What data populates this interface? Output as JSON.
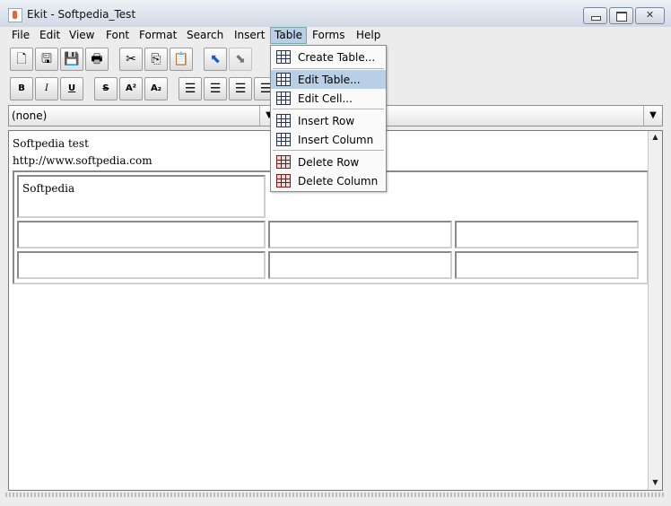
{
  "window": {
    "title": "Ekit - Softpedia_Test"
  },
  "menubar": [
    "File",
    "Edit",
    "View",
    "Font",
    "Format",
    "Search",
    "Insert",
    "Table",
    "Forms",
    "Help"
  ],
  "table_menu": {
    "items": [
      "Create Table...",
      "Edit Table...",
      "Edit Cell...",
      "Insert Row",
      "Insert Column",
      "Delete Row",
      "Delete Column"
    ],
    "highlighted": "Edit Table..."
  },
  "toolbar1": {
    "icons": [
      "new-document-icon",
      "open-icon",
      "save-icon",
      "print-icon",
      "cut-icon",
      "copy-icon",
      "paste-icon",
      "undo-icon",
      "redo-icon"
    ]
  },
  "toolbar2": {
    "bold": "B",
    "italic": "I",
    "underline": "U",
    "strike": "S",
    "superscript": "A²",
    "subscript": "A₂"
  },
  "style_combo": {
    "value": "(none)"
  },
  "editor": {
    "line1": "Softpedia test",
    "line2": "http://www.softpedia.com",
    "cell_text": "Softpedia"
  },
  "colors": {
    "menu_highlight": "#b8cfe5",
    "window_bg": "#ececec"
  }
}
